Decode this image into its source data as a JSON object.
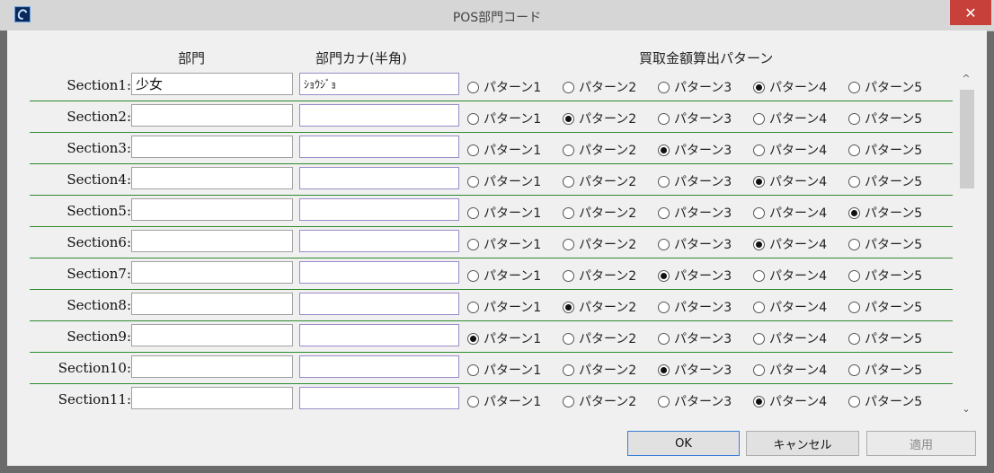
{
  "window": {
    "title": "POS部門コード",
    "close_label": "✕"
  },
  "columns": {
    "name": "部門",
    "kana": "部門カナ(半角)",
    "pattern": "買取金額算出パターン"
  },
  "pattern_labels": [
    "パターン1",
    "パターン2",
    "パターン3",
    "パターン4",
    "パターン5"
  ],
  "rows": [
    {
      "label": "Section1:",
      "name": "少女",
      "kana": "ｼｮｳｼﾞｮ",
      "selected": 4
    },
    {
      "label": "Section2:",
      "name": "",
      "kana": "",
      "selected": 2
    },
    {
      "label": "Section3:",
      "name": "",
      "kana": "",
      "selected": 3
    },
    {
      "label": "Section4:",
      "name": "",
      "kana": "",
      "selected": 4
    },
    {
      "label": "Section5:",
      "name": "",
      "kana": "",
      "selected": 5
    },
    {
      "label": "Section6:",
      "name": "",
      "kana": "",
      "selected": 4
    },
    {
      "label": "Section7:",
      "name": "",
      "kana": "",
      "selected": 3
    },
    {
      "label": "Section8:",
      "name": "",
      "kana": "",
      "selected": 2
    },
    {
      "label": "Section9:",
      "name": "",
      "kana": "",
      "selected": 1
    },
    {
      "label": "Section10:",
      "name": "",
      "kana": "",
      "selected": 3
    },
    {
      "label": "Section11:",
      "name": "",
      "kana": "",
      "selected": 4
    }
  ],
  "scroll": {
    "up": "^",
    "down": "⌄"
  },
  "buttons": {
    "ok": "OK",
    "cancel": "キャンセル",
    "apply": "適用"
  },
  "colors": {
    "row_separator": "#2e8b2e",
    "close_button": "#c7403a",
    "ok_border": "#3c7fd6"
  }
}
